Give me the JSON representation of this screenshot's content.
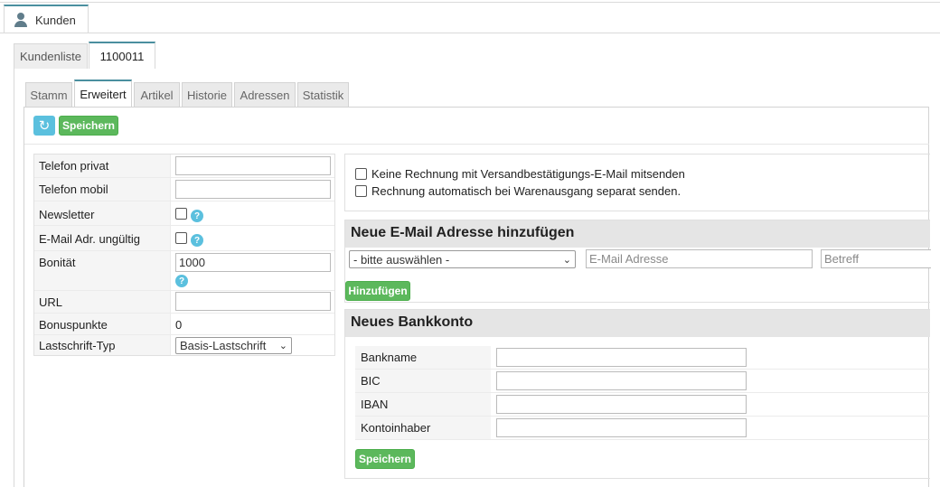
{
  "window": {
    "tab_label": "Kunden",
    "tab_icon": "user-icon"
  },
  "subtabs": [
    {
      "label": "Kundenliste",
      "active": false
    },
    {
      "label": "1100011",
      "active": true
    }
  ],
  "inner_tabs": [
    {
      "label": "Stamm",
      "active": false
    },
    {
      "label": "Erweitert",
      "active": true
    },
    {
      "label": "Artikel",
      "active": false
    },
    {
      "label": "Historie",
      "active": false
    },
    {
      "label": "Adressen",
      "active": false
    },
    {
      "label": "Statistik",
      "active": false
    }
  ],
  "toolbar": {
    "refresh_icon": "refresh-icon",
    "save_label": "Speichern"
  },
  "form": {
    "telefon_privat": {
      "label": "Telefon privat",
      "value": ""
    },
    "telefon_mobil": {
      "label": "Telefon mobil",
      "value": ""
    },
    "newsletter": {
      "label": "Newsletter",
      "checked": false
    },
    "email_invalid": {
      "label": "E-Mail Adr. ungültig",
      "checked": false
    },
    "bonitaet": {
      "label": "Bonität",
      "value": "1000"
    },
    "url": {
      "label": "URL",
      "value": ""
    },
    "bonuspunkte": {
      "label": "Bonuspunkte",
      "value": "0"
    },
    "lastschrift": {
      "label": "Lastschrift-Typ",
      "value": "Basis-Lastschrift"
    },
    "help_glyph": "?"
  },
  "options": {
    "no_invoice": "Keine Rechnung mit Versandbestätigungs-E-Mail mitsenden",
    "auto_invoice": "Rechnung automatisch bei Warenausgang separat senden."
  },
  "email_section": {
    "title": "Neue E-Mail Adresse hinzufügen",
    "type_select": "- bitte auswählen -",
    "email_placeholder": "E-Mail Adresse",
    "subject_placeholder": "Betreff",
    "add_label": "Hinzufügen"
  },
  "bank_section": {
    "title": "Neues Bankkonto",
    "fields": [
      {
        "label": "Bankname",
        "value": ""
      },
      {
        "label": "BIC",
        "value": ""
      },
      {
        "label": "IBAN",
        "value": ""
      },
      {
        "label": "Kontoinhaber",
        "value": ""
      }
    ],
    "save_label": "Speichern"
  },
  "colors": {
    "accent": "#4a8f9f",
    "success": "#5cb85c",
    "info": "#5bc0de"
  }
}
